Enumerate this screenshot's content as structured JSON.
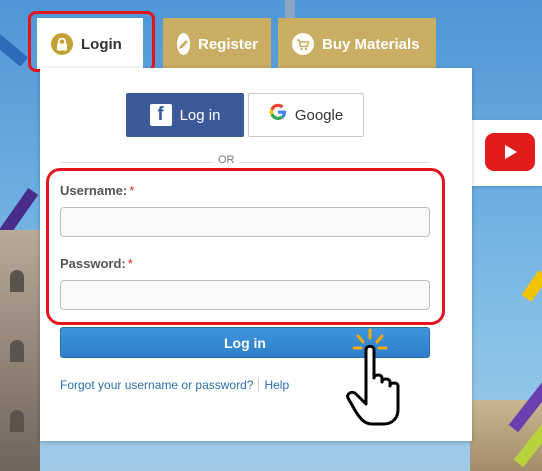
{
  "tabs": [
    {
      "label": "Login",
      "icon": "lock-icon",
      "active": true
    },
    {
      "label": "Register",
      "icon": "pencil-icon",
      "active": false
    },
    {
      "label": "Buy Materials",
      "icon": "cart-icon",
      "active": false
    }
  ],
  "social": {
    "facebook_label": "Log in",
    "google_label": "Google"
  },
  "divider_text": "OR",
  "form": {
    "username_label": "Username:",
    "password_label": "Password:",
    "required_mark": "*",
    "username_value": "",
    "password_value": "",
    "submit_label": "Log in"
  },
  "links": {
    "forgot": "Forgot your username or password?",
    "help": "Help"
  },
  "colors": {
    "tab_gold": "#c9ad62",
    "highlight_red": "#e3141d",
    "facebook_blue": "#3c5a99",
    "button_blue": "#2e7fca",
    "youtube_red": "#e21c1c"
  }
}
